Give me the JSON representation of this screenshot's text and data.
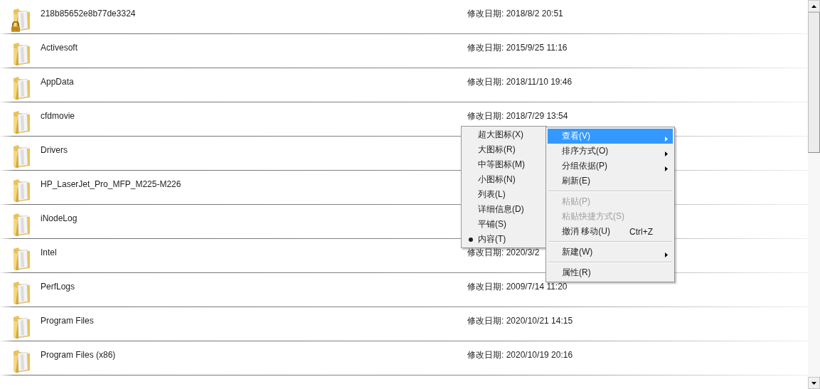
{
  "folders": [
    {
      "name": "218b85652e8b77de3324",
      "date": "修改日期: 2018/8/2 20:51",
      "locked": true
    },
    {
      "name": "Activesoft",
      "date": "修改日期: 2015/9/25 11:16",
      "locked": false
    },
    {
      "name": "AppData",
      "date": "修改日期: 2018/11/10 19:46",
      "locked": false
    },
    {
      "name": "cfdmovie",
      "date": "修改日期: 2018/7/29 13:54",
      "locked": false
    },
    {
      "name": "Drivers",
      "locked": false
    },
    {
      "name": "HP_LaserJet_Pro_MFP_M225-M226",
      "locked": false
    },
    {
      "name": "iNodeLog",
      "locked": false
    },
    {
      "name": "Intel",
      "date": "修改日期: 2020/3/2",
      "locked": false
    },
    {
      "name": "PerfLogs",
      "date": "修改日期: 2009/7/14 11:20",
      "locked": false
    },
    {
      "name": "Program Files",
      "date": "修改日期: 2020/10/21 14:15",
      "locked": false
    },
    {
      "name": "Program Files (x86)",
      "date": "修改日期: 2020/10/19 20:16",
      "locked": false
    }
  ],
  "context_menu": [
    {
      "kind": "item",
      "label": "查看(V)",
      "selected": true,
      "submenu": true
    },
    {
      "kind": "item",
      "label": "排序方式(O)",
      "selected": false,
      "submenu": true
    },
    {
      "kind": "item",
      "label": "分组依据(P)",
      "selected": false,
      "submenu": true
    },
    {
      "kind": "item",
      "label": "刷新(E)",
      "selected": false,
      "submenu": false
    },
    {
      "kind": "separator"
    },
    {
      "kind": "item",
      "label": "粘贴(P)",
      "selected": false,
      "submenu": false,
      "disabled": true
    },
    {
      "kind": "item",
      "label": "粘贴快捷方式(S)",
      "selected": false,
      "submenu": false,
      "disabled": true
    },
    {
      "kind": "item",
      "label": "撤消 移动(U)",
      "shortcut": "Ctrl+Z",
      "selected": false,
      "submenu": false
    },
    {
      "kind": "separator"
    },
    {
      "kind": "item",
      "label": "新建(W)",
      "selected": false,
      "submenu": true
    },
    {
      "kind": "separator"
    },
    {
      "kind": "item",
      "label": "属性(R)",
      "selected": false,
      "submenu": false
    }
  ],
  "view_submenu": [
    {
      "label": "超大图标(X)",
      "selected": false
    },
    {
      "label": "大图标(R)",
      "selected": false
    },
    {
      "label": "中等图标(M)",
      "selected": false
    },
    {
      "label": "小图标(N)",
      "selected": false
    },
    {
      "label": "列表(L)",
      "selected": false
    },
    {
      "label": "详细信息(D)",
      "selected": false
    },
    {
      "label": "平铺(S)",
      "selected": false
    },
    {
      "label": "内容(T)",
      "selected": true
    }
  ]
}
